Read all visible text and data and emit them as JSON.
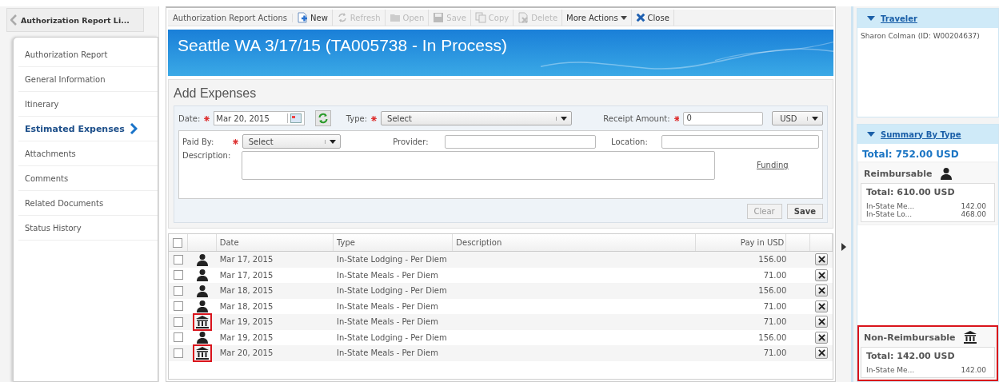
{
  "back_button": {
    "label": "Authorization Report Li..."
  },
  "nav": [
    {
      "label": "Authorization Report",
      "selected": false
    },
    {
      "label": "General Information",
      "selected": false
    },
    {
      "label": "Itinerary",
      "selected": false
    },
    {
      "label": "Estimated Expenses",
      "selected": true
    },
    {
      "label": "Attachments",
      "selected": false
    },
    {
      "label": "Comments",
      "selected": false
    },
    {
      "label": "Related Documents",
      "selected": false
    },
    {
      "label": "Status History",
      "selected": false
    }
  ],
  "toolbar": {
    "title": "Authorization Report Actions",
    "buttons": [
      {
        "label": "New",
        "kind": "new",
        "disabled": false
      },
      {
        "label": "Refresh",
        "kind": "refresh",
        "disabled": true
      },
      {
        "label": "Open",
        "kind": "open",
        "disabled": true
      },
      {
        "label": "Save",
        "kind": "save",
        "disabled": true
      },
      {
        "label": "Copy",
        "kind": "copy",
        "disabled": true
      },
      {
        "label": "Delete",
        "kind": "delete",
        "disabled": true
      },
      {
        "label": "More Actions",
        "kind": "menu",
        "disabled": false
      },
      {
        "label": "Close",
        "kind": "close",
        "disabled": false
      }
    ]
  },
  "banner": {
    "title": "Seattle WA 3/17/15 (TA005738 - In Process)"
  },
  "add_expenses": {
    "title": "Add Expenses",
    "date": {
      "label": "Date:",
      "value": "Mar 20, 2015",
      "required": true
    },
    "type": {
      "label": "Type:",
      "value": "Select",
      "required": true
    },
    "receipt_amount": {
      "label": "Receipt Amount:",
      "value": "0",
      "required": true
    },
    "currency": {
      "value": "USD"
    },
    "paid_by": {
      "label": "Paid By:",
      "value": "Select",
      "required": true
    },
    "provider": {
      "label": "Provider:"
    },
    "location": {
      "label": "Location:"
    },
    "description": {
      "label": "Description:"
    },
    "funding_link": "Funding",
    "buttons": [
      {
        "label": "Clear",
        "disabled": true
      },
      {
        "label": "Save",
        "disabled": false
      }
    ]
  },
  "grid": {
    "select_all_checked": false,
    "columns": [
      "Date",
      "Type",
      "Description",
      "Pay in USD"
    ],
    "rows": [
      {
        "checked": false,
        "kind": "person",
        "highlighted": false,
        "date": "Mar 17, 2015",
        "type": "In-State Lodging - Per Diem",
        "amount": "156.00"
      },
      {
        "checked": false,
        "kind": "person",
        "highlighted": false,
        "date": "Mar 17, 2015",
        "type": "In-State Meals - Per Diem",
        "amount": "71.00"
      },
      {
        "checked": false,
        "kind": "person",
        "highlighted": false,
        "date": "Mar 18, 2015",
        "type": "In-State Lodging - Per Diem",
        "amount": "156.00"
      },
      {
        "checked": false,
        "kind": "person",
        "highlighted": false,
        "date": "Mar 18, 2015",
        "type": "In-State Meals - Per Diem",
        "amount": "71.00"
      },
      {
        "checked": false,
        "kind": "institution",
        "highlighted": true,
        "date": "Mar 19, 2015",
        "type": "In-State Meals - Per Diem",
        "amount": "71.00"
      },
      {
        "checked": false,
        "kind": "person",
        "highlighted": false,
        "date": "Mar 19, 2015",
        "type": "In-State Lodging - Per Diem",
        "amount": "156.00"
      },
      {
        "checked": false,
        "kind": "institution",
        "highlighted": true,
        "date": "Mar 20, 2015",
        "type": "In-State Meals - Per Diem",
        "amount": "71.00"
      }
    ]
  },
  "traveler": {
    "title": "Traveler",
    "expanded": true,
    "text": "Sharon Colman (ID: W00204637)"
  },
  "summary": {
    "title": "Summary By Type",
    "expanded": true,
    "total": "Total: 752.00 USD",
    "groups": [
      {
        "title": "Reimbursable",
        "kind": "person",
        "highlighted": false,
        "total": "Total: 610.00 USD",
        "items": [
          {
            "name": "In-State Me...",
            "amount": "142.00"
          },
          {
            "name": "In-State Lo...",
            "amount": "468.00"
          }
        ]
      },
      {
        "title": "Non-Reimbursable",
        "kind": "institution",
        "highlighted": true,
        "total": "Total: 142.00 USD",
        "items": [
          {
            "name": "In-State Me...",
            "amount": "142.00"
          }
        ]
      }
    ]
  }
}
